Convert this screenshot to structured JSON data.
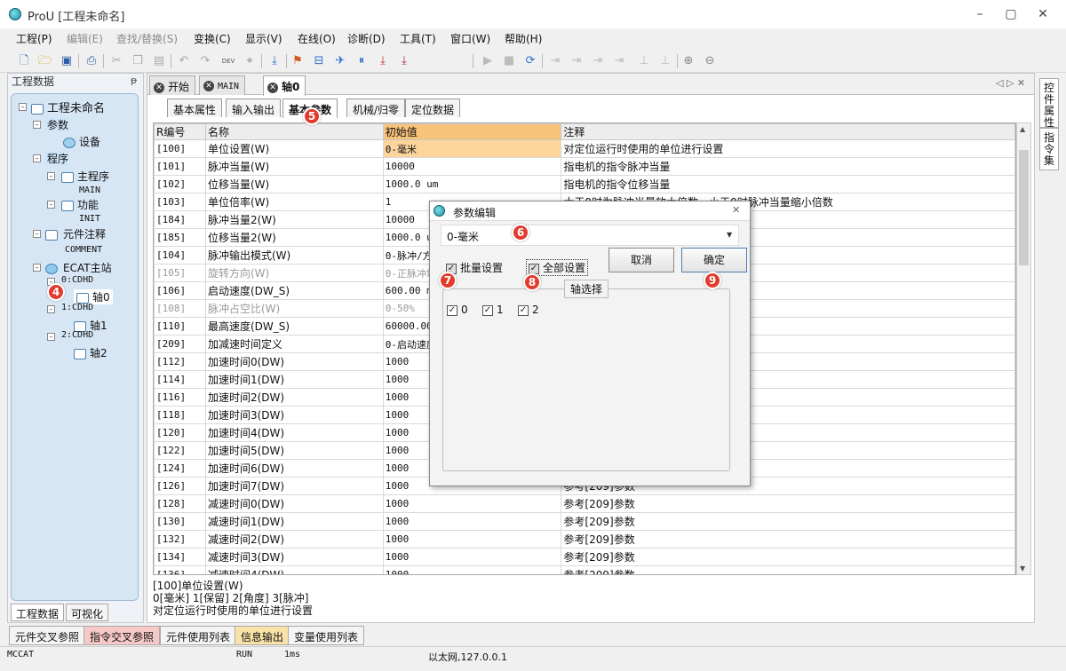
{
  "window": {
    "title": "ProU [工程未命名]",
    "minimize": "–",
    "maximize": "▢",
    "close": "✕"
  },
  "menu": [
    {
      "label": "工程(P)",
      "disabled": false
    },
    {
      "label": "编辑(E)",
      "disabled": true
    },
    {
      "label": "查找/替换(S)",
      "disabled": true
    },
    {
      "label": "变换(C)",
      "disabled": false
    },
    {
      "label": "显示(V)",
      "disabled": false
    },
    {
      "label": "在线(O)",
      "disabled": false
    },
    {
      "label": "诊断(D)",
      "disabled": false
    },
    {
      "label": "工具(T)",
      "disabled": false
    },
    {
      "label": "窗口(W)",
      "disabled": false
    },
    {
      "label": "帮助(H)",
      "disabled": false
    }
  ],
  "toolbar": {
    "dev_label": "DEV"
  },
  "left_panel": {
    "title": "工程数据",
    "pin": "ᵽ",
    "tree": {
      "root": "工程未命名",
      "params": "参数",
      "device": "设备",
      "program": "程序",
      "main_program": "主程序",
      "main": "MAIN",
      "function": "功能",
      "init": "INIT",
      "comment_group": "元件注释",
      "comment": "COMMENT",
      "ecat": "ECAT主站",
      "node0": "0:CDHD",
      "axis0": "轴0",
      "node1": "1:CDHD",
      "axis1": "轴1",
      "node2": "2:CDHD",
      "axis2": "轴2"
    },
    "tabs": [
      "工程数据",
      "可视化"
    ]
  },
  "doc_tabs": [
    {
      "label": "开始"
    },
    {
      "label": "MAIN"
    },
    {
      "label": "轴0"
    }
  ],
  "doc_nav": "◁ ▷ ✕",
  "param_tabs": [
    "基本属性",
    "输入输出",
    "基本参数",
    "机械/归零",
    "定位数据"
  ],
  "grid": {
    "headers": [
      "R编号",
      "名称",
      "初始值",
      "注释"
    ],
    "rows": [
      {
        "id": "[100]",
        "name": "单位设置(W)",
        "value": "0-毫米",
        "note": "对定位运行时使用的单位进行设置",
        "gray": false
      },
      {
        "id": "[101]",
        "name": "脉冲当量(W)",
        "value": "10000",
        "note": "指电机的指令脉冲当量",
        "gray": false
      },
      {
        "id": "[102]",
        "name": "位移当量(W)",
        "value": "1000.0 um",
        "note": "指电机的指令位移当量",
        "gray": false
      },
      {
        "id": "[103]",
        "name": "单位倍率(W)",
        "value": "1",
        "note": "大于0时为脉冲当量放大倍数，小于0时脉冲当量缩小倍数",
        "gray": false
      },
      {
        "id": "[184]",
        "name": "脉冲当量2(W)",
        "value": "10000",
        "note": "",
        "gray": false
      },
      {
        "id": "[185]",
        "name": "位移当量2(W)",
        "value": "1000.0 um",
        "note": "",
        "gray": false
      },
      {
        "id": "[104]",
        "name": "脉冲输出模式(W)",
        "value": "0-脉冲/方向",
        "note": "",
        "gray": false
      },
      {
        "id": "[105]",
        "name": "旋转方向(W)",
        "value": "0-正脉冲增加",
        "note": "系",
        "gray": true
      },
      {
        "id": "[106]",
        "name": "启动速度(DW_S)",
        "value": "600.00 mm",
        "note": "",
        "gray": false
      },
      {
        "id": "[108]",
        "name": "脉冲占空比(W)",
        "value": "0-50%",
        "note": "",
        "gray": true
      },
      {
        "id": "[110]",
        "name": "最高速度(DW_S)",
        "value": "60000.00",
        "note": "",
        "gray": false
      },
      {
        "id": "[209]",
        "name": "加减速时间定义",
        "value": "0-启动速度",
        "note": "",
        "gray": false
      },
      {
        "id": "[112]",
        "name": "加速时间0(DW)",
        "value": "1000",
        "note": "",
        "gray": false
      },
      {
        "id": "[114]",
        "name": "加速时间1(DW)",
        "value": "1000",
        "note": "",
        "gray": false
      },
      {
        "id": "[116]",
        "name": "加速时间2(DW)",
        "value": "1000",
        "note": "",
        "gray": false
      },
      {
        "id": "[118]",
        "name": "加速时间3(DW)",
        "value": "1000",
        "note": "",
        "gray": false
      },
      {
        "id": "[120]",
        "name": "加速时间4(DW)",
        "value": "1000",
        "note": "",
        "gray": false
      },
      {
        "id": "[122]",
        "name": "加速时间5(DW)",
        "value": "1000",
        "note": "",
        "gray": false
      },
      {
        "id": "[124]",
        "name": "加速时间6(DW)",
        "value": "1000",
        "note": "",
        "gray": false
      },
      {
        "id": "[126]",
        "name": "加速时间7(DW)",
        "value": "1000",
        "note": "参考[209]参数",
        "gray": false
      },
      {
        "id": "[128]",
        "name": "减速时间0(DW)",
        "value": "1000",
        "note": "参考[209]参数",
        "gray": false
      },
      {
        "id": "[130]",
        "name": "减速时间1(DW)",
        "value": "1000",
        "note": "参考[209]参数",
        "gray": false
      },
      {
        "id": "[132]",
        "name": "减速时间2(DW)",
        "value": "1000",
        "note": "参考[209]参数",
        "gray": false
      },
      {
        "id": "[134]",
        "name": "减速时间3(DW)",
        "value": "1000",
        "note": "参考[209]参数",
        "gray": false
      },
      {
        "id": "[136]",
        "name": "减速时间4(DW)",
        "value": "1000",
        "note": "参考[209]参数",
        "gray": false
      }
    ]
  },
  "description": [
    "[100]单位设置(W)",
    "0[毫米] 1[保留] 2[角度] 3[脉冲]",
    "对定位运行时使用的单位进行设置"
  ],
  "right_tabs": [
    "控件属性",
    "指令集"
  ],
  "bottom_tabs": [
    {
      "label": "元件交叉参照",
      "color": "#f4f4f4"
    },
    {
      "label": "指令交叉参照",
      "color": "#f6c8c8"
    },
    {
      "label": "元件使用列表",
      "color": "#f4f4f4"
    },
    {
      "label": "信息输出",
      "color": "#f9e3a8"
    },
    {
      "label": "变量使用列表",
      "color": "#f4f4f4"
    }
  ],
  "status": {
    "left": "MCCAT",
    "run": "RUN",
    "cycle": "1ms",
    "network": "以太网,127.0.0.1"
  },
  "dialog": {
    "title": "参数编辑",
    "close": "✕",
    "select_value": "0-毫米",
    "batch_label": "批量设置",
    "all_label": "全部设置",
    "cancel": "取消",
    "ok": "确定",
    "axis_group": "轴选择",
    "axes": [
      {
        "label": "0",
        "checked": true
      },
      {
        "label": "1",
        "checked": true
      },
      {
        "label": "2",
        "checked": true
      }
    ],
    "check_mark": "✓"
  },
  "badges": [
    "4",
    "5",
    "6",
    "7",
    "8",
    "9"
  ]
}
